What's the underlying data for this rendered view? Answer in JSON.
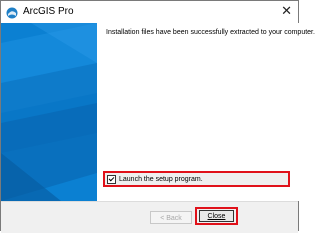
{
  "window": {
    "title": "ArcGIS Pro",
    "close_glyph": "✕"
  },
  "content": {
    "message": "Installation files have been successfully extracted to your computer.",
    "launch_checkbox": {
      "label": "Launch the setup program.",
      "checked": true
    }
  },
  "footer": {
    "back_label": "< Back",
    "close_label": "Close"
  },
  "colors": {
    "accent_blue": "#0a7fd0",
    "highlight_red": "#e0111a"
  },
  "icons": {
    "app": "arcgis-pro-icon",
    "close": "close-icon",
    "check": "checkmark-icon"
  }
}
